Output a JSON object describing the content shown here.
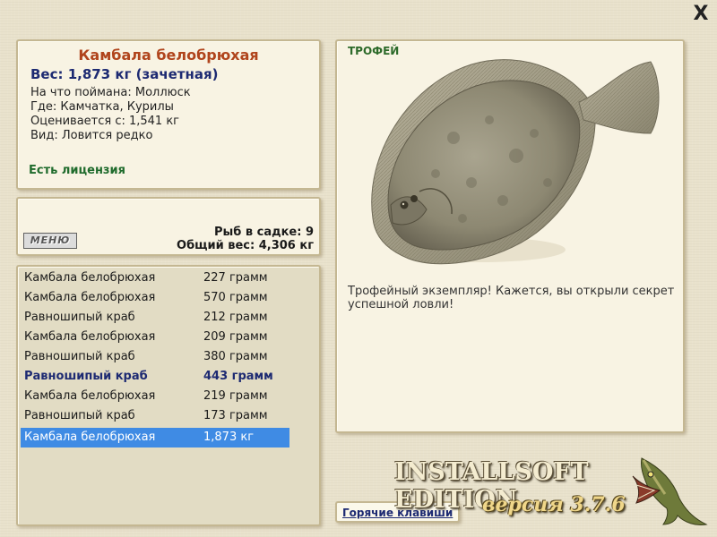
{
  "window": {
    "close_symbol": "X"
  },
  "info": {
    "fish_name": "Камбала белобрюхая",
    "weight_line": "Вес: 1,873 кг (зачетная)",
    "bait": "На что поймана: Моллюск",
    "place": "Где: Камчатка, Курилы",
    "valued_from": "Оценивается с: 1,541 кг",
    "kind": "Вид: Ловится редко",
    "license": "Есть лицензия"
  },
  "menu": {
    "button_label": "МЕНЮ",
    "keepnet_count": "Рыб в садке: 9",
    "keepnet_total": "Общий вес: 4,306 кг"
  },
  "catch_list": [
    {
      "name": "Камбала белобрюхая",
      "weight": "227 грамм"
    },
    {
      "name": "Камбала белобрюхая",
      "weight": "570 грамм"
    },
    {
      "name": "Равношипый краб",
      "weight": "212 грамм"
    },
    {
      "name": "Камбала белобрюхая",
      "weight": "209 грамм"
    },
    {
      "name": "Равношипый краб",
      "weight": "380 грамм"
    },
    {
      "name": "Равношипый краб",
      "weight": "443 грамм"
    },
    {
      "name": "Камбала белобрюхая",
      "weight": "219 грамм"
    },
    {
      "name": "Равношипый краб",
      "weight": "173 грамм"
    },
    {
      "name": "Камбала белобрюхая",
      "weight": "1,873 кг"
    }
  ],
  "trophy": {
    "label": "ТРОФЕЙ",
    "image_icon": "flounder-fish-icon",
    "description": "Трофейный экземпляр! Кажется, вы открыли секрет успешной ловли!"
  },
  "footer": {
    "hotkeys": "Горячие клавиши",
    "edition": "INSTALLSOFT EDITION",
    "version": "версия 3.7.6",
    "logo_icon": "pike-fish-icon"
  },
  "colors": {
    "background": "#e9e2cc",
    "panel": "#f8f3e3",
    "title": "#b0441c",
    "weight": "#1d2a72",
    "license": "#1f6b2c",
    "selection": "#3f8be4"
  }
}
